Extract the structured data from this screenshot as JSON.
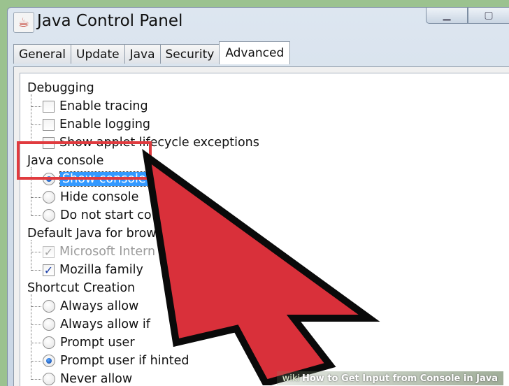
{
  "window": {
    "title": "Java Control Panel",
    "app_icon": "java-cup-icon"
  },
  "tabs": [
    {
      "label": "General",
      "active": false
    },
    {
      "label": "Update",
      "active": false
    },
    {
      "label": "Java",
      "active": false
    },
    {
      "label": "Security",
      "active": false
    },
    {
      "label": "Advanced",
      "active": true
    }
  ],
  "tree": {
    "debugging": {
      "heading": "Debugging",
      "items": [
        {
          "label": "Enable tracing",
          "checked": false
        },
        {
          "label": "Enable logging",
          "checked": false
        },
        {
          "label": "Show applet lifecycle exceptions",
          "checked": false
        }
      ]
    },
    "java_console": {
      "heading": "Java console",
      "items": [
        {
          "label": "Show console",
          "selected": true
        },
        {
          "label": "Hide console",
          "selected": false
        },
        {
          "label": "Do not start co",
          "selected": false
        }
      ]
    },
    "default_java": {
      "heading": "Default Java for brow",
      "items": [
        {
          "label": "Microsoft Intern",
          "checked": true,
          "disabled": true
        },
        {
          "label": "Mozilla family",
          "checked": true,
          "disabled": false
        }
      ]
    },
    "shortcut": {
      "heading": "Shortcut Creation",
      "items": [
        {
          "label": "Always allow",
          "selected": false
        },
        {
          "label": "Always allow if",
          "selected": false
        },
        {
          "label": "Prompt user",
          "selected": false
        },
        {
          "label": "Prompt user if hinted",
          "selected": true
        },
        {
          "label": "Never allow",
          "selected": false
        }
      ]
    }
  },
  "watermark": {
    "wiki": "wiki",
    "text": "How to Get Input from Console in Java"
  },
  "colors": {
    "highlight": "#e03b3f",
    "arrow": "#d9303a",
    "selection": "#3399ff"
  }
}
